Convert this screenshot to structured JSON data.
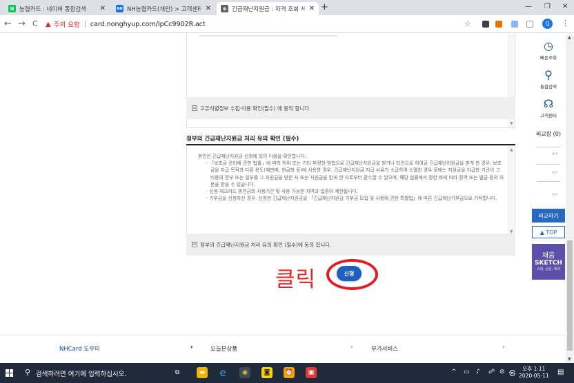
{
  "browser": {
    "tabs": [
      {
        "title": "농협카드 : 네이버 통합검색",
        "close": "✕",
        "favicon_color": "#03c75a",
        "favicon_text": "N"
      },
      {
        "title": "NH농협카드(개인) > 고객센터 > ",
        "close": "✕",
        "favicon_color": "#1a73e8",
        "favicon_text": "NH"
      },
      {
        "title": "긴급재난지원금 : 자격 조회 서비",
        "close": "✕",
        "favicon_color": "#5f6368",
        "favicon_text": "⊕"
      }
    ],
    "new_tab": "+",
    "window_controls": [
      "—",
      "❐",
      "✕"
    ],
    "nav": {
      "back": "←",
      "forward": "→",
      "reload": "C"
    },
    "security_warning": "주의 요함",
    "url": "card.nonghyup.com/IpCc9902R.act",
    "profile_initial": "Q",
    "kebab": "⋮"
  },
  "page": {
    "consent_privacy": "고유식별정보 수집·이용 확인(필수) 에 동의 합니다.",
    "notice_section_title": "정부의 긴급재난지원금 처리 유의 확인 (필수)",
    "notice_paragraphs": [
      "본인은 긴급재난지원금 신청에 있어 다음을 확인합니다.",
      "· 「보조금 관리에 관한 법률」에 따라 허위 또는 기타 부정한 방법으로 긴급재난지원금을 받거나 타인으로 하여금 긴급재난지원금을 받게 한 경우, 보조금을 지급 목적과 다른 용도(재판매, 현금화 등)에 사용한 경우, 긴급재난지원금 지급 사유가 소급하여 소멸한 경우 등에는 지원금을 지급한 기관이 그 비용의 전부 또는 일부를 그 지원금을 받은 자 또는 지원금을 받게 한 자로부터 환수할 수 있으며, 해당 법률에서 정한 바에 따라 징역 또는 벌금 등의 처분을 받을 수 있습니다.",
      "· 신용·체크카드 충전금의 사용기간 및 사용 가능한 지역과 업종이 제한됩니다.",
      "· 기부금을 신청하신 경우, 신청한 긴급재난지원금을 「긴급재난지원금 기부금 모집 및 사용에 관한 특별법」에 따른 긴급재난기부금으로 기탁합니다."
    ],
    "consent_notice": "정부의 긴급재난지원금 처리 유의 확인 (필수)에 동의 합니다.",
    "checkbox_mark": "☑",
    "click_annotation": "클릭",
    "apply_button": "신청"
  },
  "quick_menu": {
    "items": [
      {
        "label": "빠른조회",
        "icon": "clock-icon",
        "glyph": "◷"
      },
      {
        "label": "통합검색",
        "icon": "search-icon",
        "glyph": "⚲"
      },
      {
        "label": "고객센터",
        "icon": "headset-icon",
        "glyph": "☊"
      }
    ],
    "compare_title": "비교함 (0)",
    "slot_label": "0/4",
    "compare_button": "비교하기",
    "top_button": "▲ TOP",
    "banner": {
      "line1": "채움",
      "line2": "SKETCH",
      "line3": "쇼핑, 금융, 혜택"
    }
  },
  "footer": {
    "items": [
      "NHCard 도우미",
      "오늘본상품",
      "부가서비스"
    ],
    "caret": "▾"
  },
  "taskbar": {
    "search_placeholder": "검색하려면 여기에 입력하십시오.",
    "time": "오후 1:11",
    "date": "2020-05-11",
    "ime": "A",
    "apps": [
      {
        "name": "task-view",
        "color": "#1f2a3a",
        "glyph": "⧉"
      },
      {
        "name": "file-explorer",
        "color": "#f0b400",
        "glyph": "▬"
      },
      {
        "name": "edge",
        "color": "#1f2a3a",
        "glyph": "e"
      },
      {
        "name": "chrome",
        "color": "#1f2a3a",
        "glyph": "◉"
      },
      {
        "name": "kakaotalk",
        "color": "#f7d600",
        "glyph": "◙"
      },
      {
        "name": "alarm",
        "color": "#e9a800",
        "glyph": "⏰"
      },
      {
        "name": "app",
        "color": "#e03b3b",
        "glyph": "▣"
      }
    ],
    "tray_icons": [
      "^",
      "▭",
      "♪",
      "☍",
      "⊘",
      "㉿"
    ]
  },
  "colors": {
    "accent": "#1f5fbf",
    "annotation": "#e01b22",
    "brand": "#1a4c8e"
  }
}
